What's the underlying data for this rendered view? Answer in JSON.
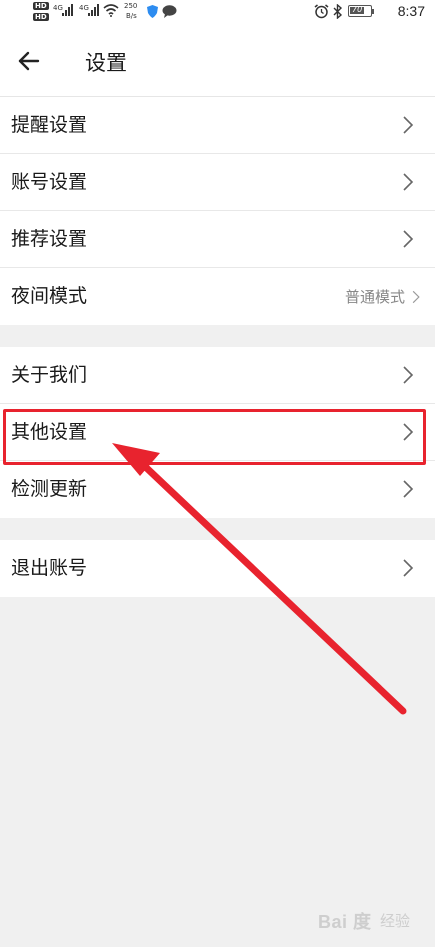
{
  "status_bar": {
    "hd1": "HD",
    "hd2": "HD",
    "net1": "4G",
    "net2": "4G",
    "speed_value": "250",
    "speed_unit": "B/s",
    "battery": "70",
    "time": "8:37"
  },
  "header": {
    "title": "设置"
  },
  "groups": [
    {
      "items": [
        {
          "label": "提醒设置"
        },
        {
          "label": "账号设置"
        },
        {
          "label": "推荐设置"
        },
        {
          "label": "夜间模式",
          "value": "普通模式"
        }
      ]
    },
    {
      "items": [
        {
          "label": "关于我们"
        },
        {
          "label": "其他设置"
        },
        {
          "label": "检测更新"
        }
      ]
    },
    {
      "items": [
        {
          "label": "退出账号"
        }
      ]
    }
  ],
  "annotation": {
    "color": "#e8232e"
  },
  "watermark": {
    "brand": "Bai 度",
    "sub": "经验"
  }
}
